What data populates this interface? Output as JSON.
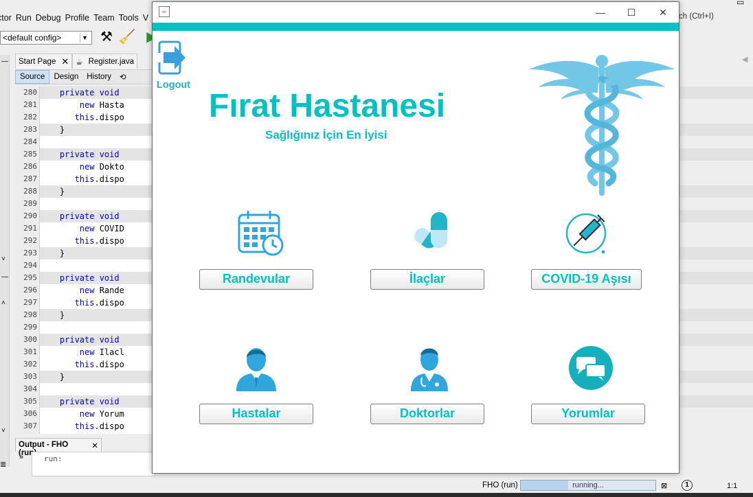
{
  "ide": {
    "menu": [
      "ctor",
      "Run",
      "Debug",
      "Profile",
      "Team",
      "Tools",
      "V"
    ],
    "config_select": "<default config>",
    "search_hint": "ch (Ctrl+I)",
    "editor_tabs": [
      "Start Page",
      "Register.java"
    ],
    "source_tabs": [
      "Source",
      "Design",
      "History"
    ],
    "code_lines": [
      {
        "n": "280",
        "text": "    private void",
        "fold": true,
        "hl": true
      },
      {
        "n": "281",
        "text": "        new Hasta",
        "fold": false,
        "hl": false
      },
      {
        "n": "282",
        "text": "       this.dispo",
        "fold": false,
        "hl": false
      },
      {
        "n": "283",
        "text": "    }",
        "fold": false,
        "hl": true
      },
      {
        "n": "284",
        "text": "",
        "fold": false,
        "hl": false
      },
      {
        "n": "285",
        "text": "    private void",
        "fold": true,
        "hl": true
      },
      {
        "n": "286",
        "text": "        new Dokto",
        "fold": false,
        "hl": false
      },
      {
        "n": "287",
        "text": "       this.dispo",
        "fold": false,
        "hl": false
      },
      {
        "n": "288",
        "text": "    }",
        "fold": false,
        "hl": true
      },
      {
        "n": "289",
        "text": "",
        "fold": false,
        "hl": false
      },
      {
        "n": "290",
        "text": "    private void",
        "fold": true,
        "hl": true
      },
      {
        "n": "291",
        "text": "        new COVID",
        "fold": false,
        "hl": false
      },
      {
        "n": "292",
        "text": "       this.dispo",
        "fold": false,
        "hl": false
      },
      {
        "n": "293",
        "text": "    }",
        "fold": false,
        "hl": true
      },
      {
        "n": "294",
        "text": "",
        "fold": false,
        "hl": false
      },
      {
        "n": "295",
        "text": "    private void",
        "fold": true,
        "hl": true
      },
      {
        "n": "296",
        "text": "        new Rande",
        "fold": false,
        "hl": false
      },
      {
        "n": "297",
        "text": "       this.dispo",
        "fold": false,
        "hl": false
      },
      {
        "n": "298",
        "text": "    }",
        "fold": false,
        "hl": true
      },
      {
        "n": "299",
        "text": "",
        "fold": false,
        "hl": false
      },
      {
        "n": "300",
        "text": "    private void",
        "fold": true,
        "hl": true
      },
      {
        "n": "301",
        "text": "        new Ilacl",
        "fold": false,
        "hl": false
      },
      {
        "n": "302",
        "text": "       this.dispo",
        "fold": false,
        "hl": false
      },
      {
        "n": "303",
        "text": "    }",
        "fold": false,
        "hl": true
      },
      {
        "n": "304",
        "text": "",
        "fold": false,
        "hl": false
      },
      {
        "n": "305",
        "text": "    private void",
        "fold": true,
        "hl": true
      },
      {
        "n": "306",
        "text": "        new Yorum",
        "fold": false,
        "hl": false
      },
      {
        "n": "307",
        "text": "       this.dispo",
        "fold": false,
        "hl": false
      }
    ],
    "output_tab": "Output - FHO (run)",
    "output_text": "run:",
    "status_project": "FHO (run)",
    "status_progress": "running...",
    "status_notifications": "1",
    "status_position": "1:1"
  },
  "app": {
    "accent_color": "#00c2c2",
    "logout_label": "Logout",
    "title": "Fırat Hastanesi",
    "subtitle": "Sağlığınız İçin En İyisi",
    "tiles": [
      {
        "key": "randevular",
        "label": "Randevular",
        "icon": "calendar-clock-icon"
      },
      {
        "key": "ilaclar",
        "label": "İlaçlar",
        "icon": "pills-icon"
      },
      {
        "key": "covid",
        "label": "COVID-19 Aşısı",
        "icon": "vaccine-syringe-icon"
      },
      {
        "key": "hastalar",
        "label": "Hastalar",
        "icon": "patient-icon"
      },
      {
        "key": "doktorlar",
        "label": "Doktorlar",
        "icon": "doctor-icon"
      },
      {
        "key": "yorumlar",
        "label": "Yorumlar",
        "icon": "chat-bubbles-icon"
      }
    ]
  }
}
